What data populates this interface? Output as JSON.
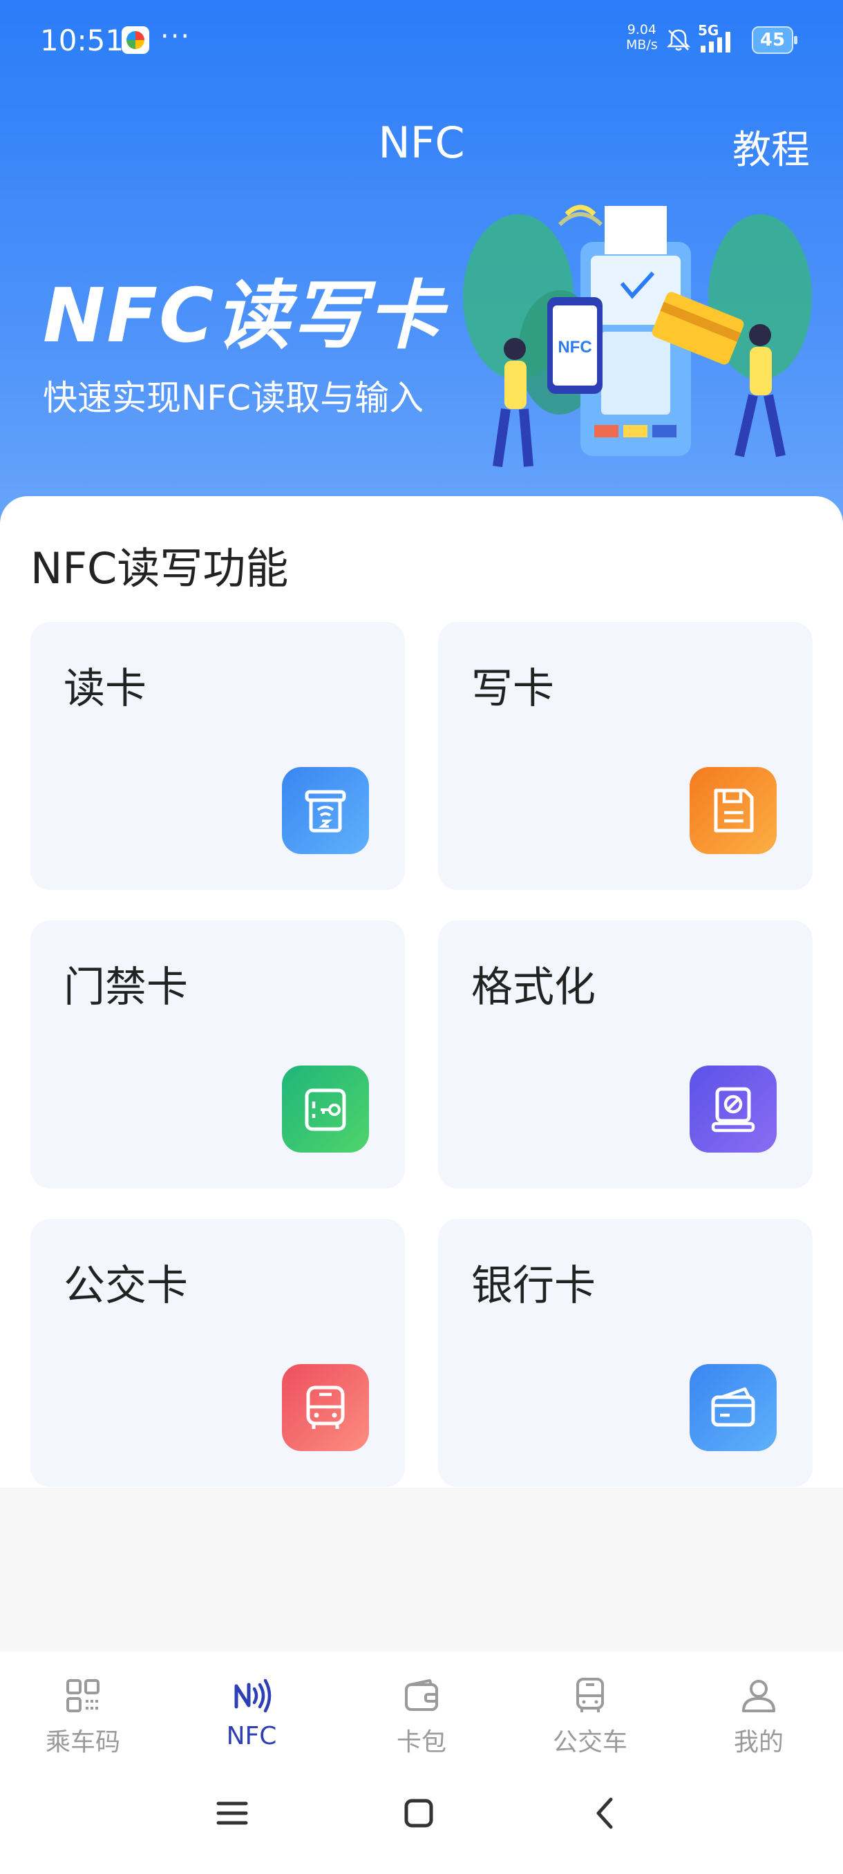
{
  "status_bar": {
    "time": "10:51",
    "more": "···",
    "speed_value": "9.04",
    "speed_unit": "MB/s",
    "network": "5G",
    "battery": "45"
  },
  "nav": {
    "title": "NFC",
    "tutorial_label": "教程"
  },
  "banner": {
    "title": "NFC读写卡",
    "subtitle": "快速实现NFC读取与输入",
    "illustration_text": "NFC"
  },
  "section": {
    "title": "NFC读写功能"
  },
  "tiles": [
    {
      "label": "读卡",
      "icon": "card-reader-icon",
      "color_from": "#3a86f2",
      "color_to": "#5fb0fb"
    },
    {
      "label": "写卡",
      "icon": "floppy-disk-icon",
      "color_from": "#f47b1f",
      "color_to": "#fcae45"
    },
    {
      "label": "门禁卡",
      "icon": "access-key-icon",
      "color_from": "#1fb57a",
      "color_to": "#4fd46b"
    },
    {
      "label": "格式化",
      "icon": "format-icon",
      "color_from": "#5b52e8",
      "color_to": "#8a6cf2"
    },
    {
      "label": "公交卡",
      "icon": "bus-icon",
      "color_from": "#ee4f5e",
      "color_to": "#fb8d80"
    },
    {
      "label": "银行卡",
      "icon": "bank-card-icon",
      "color_from": "#3a86f2",
      "color_to": "#5fb0fb"
    }
  ],
  "tabbar": {
    "items": [
      {
        "label": "乘车码",
        "icon": "qr-code-icon",
        "active": false
      },
      {
        "label": "NFC",
        "icon": "nfc-icon",
        "active": true
      },
      {
        "label": "卡包",
        "icon": "wallet-icon",
        "active": false
      },
      {
        "label": "公交车",
        "icon": "bus-icon",
        "active": false
      },
      {
        "label": "我的",
        "icon": "user-icon",
        "active": false
      }
    ]
  },
  "colors": {
    "header_blue": "#2a7cf8",
    "tile_bg": "#f3f6fd",
    "tab_active": "#2d3fb5",
    "tab_inactive": "#9a9a9a"
  }
}
